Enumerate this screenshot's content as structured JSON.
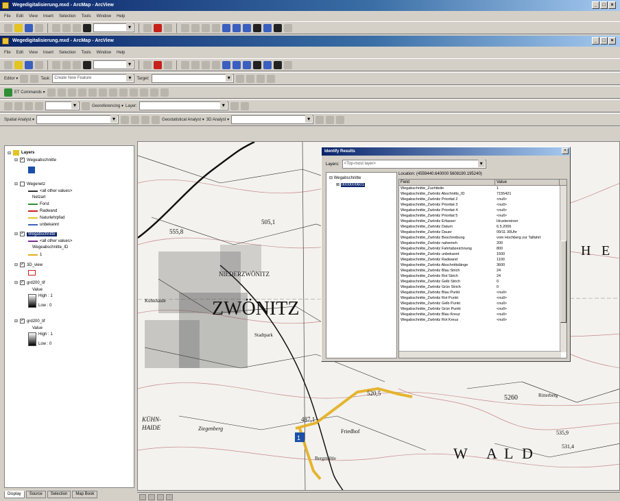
{
  "outer_window": {
    "title": "Wegedigitalisierung.mxd - ArcMap - ArcView"
  },
  "inner_window": {
    "title": "Wegedigitalisierung.mxd - ArcMap - ArcView"
  },
  "menus": [
    "File",
    "Edit",
    "View",
    "Insert",
    "Selection",
    "Tools",
    "Window",
    "Help"
  ],
  "editor_toolbar": {
    "editor_label": "Editor ▾",
    "task_label": "Task:",
    "task_value": "Create New Feature",
    "target_label": "Target:"
  },
  "toolbars": {
    "command_label": "ET Commands ▾",
    "spatial_analyst_label": "Spatial Analyst ▾",
    "georef_label": "Georeferencing ▾",
    "layer_label": "Layer:",
    "geostat_label": "Geostatistical Analyst ▾",
    "network_label": "3D Analyst ▾"
  },
  "toc": {
    "root": "Layers",
    "layers": [
      {
        "name": "Wegeabschnitte",
        "checked": true
      },
      {
        "name": "Wegenetz",
        "checked": false
      },
      {
        "name": "Wegabschnitte",
        "checked": true,
        "selected": true
      },
      {
        "name": "3D_view",
        "checked": true
      },
      {
        "name": "grd200_tif",
        "checked": true
      },
      {
        "name": "grd200_tif",
        "checked": true
      }
    ],
    "legend": {
      "all_other": "<all other values>",
      "netzart": "Netzart",
      "items": [
        "Forst",
        "Radwand",
        "Naturlehrpfad",
        "unbekannt"
      ],
      "field_label": "Wegeabschnitte_ID",
      "value_label": "Value",
      "high": "High : 1",
      "low": "Low : 0"
    },
    "tabs": [
      "Display",
      "Source",
      "Selection",
      "Map Book"
    ]
  },
  "map": {
    "labels": [
      "ZWÖNITZ",
      "H",
      "E",
      "W",
      "A",
      "L",
      "D",
      "NIEDERZWÖNITZ",
      "KÜHN-",
      "HAIDE",
      "Ziegenberg",
      "Kühnhaide",
      "Friedhof",
      "Bergmühle",
      "Ritterberg",
      "Stadtpark"
    ],
    "elevation_labels": [
      "555,8",
      "505,1",
      "487,1",
      "520,5",
      "5260",
      "535,9",
      "531,4"
    ],
    "colors": {
      "route": "#e3ad1c",
      "roads": "#222222",
      "contours": "#b45a5a"
    }
  },
  "identify": {
    "title": "Identify Results",
    "layers_label": "Layers:",
    "layers_value": "<Top-most layer>",
    "tree_root": "Wegabschnitte",
    "tree_child": "0000000601",
    "location": "Location: (4559440.640000 5608190.195240)",
    "columns": [
      "Field",
      "Value"
    ],
    "rows": [
      [
        "Wegabschnitte_Zuchtteile",
        "1"
      ],
      [
        "Wegabschnitte_Zwönitz Abschnitts_ID",
        "7155421"
      ],
      [
        "Wegabschnitte_Zwönitz Prioritat 2",
        "<null>"
      ],
      [
        "Wegabschnitte_Zwönitz Prioritat 3",
        "<null>"
      ],
      [
        "Wegabschnitte_Zwönitz Prioritat 4",
        "<null>"
      ],
      [
        "Wegabschnitte_Zwönitz Prioritat 5",
        "<null>"
      ],
      [
        "Wegabschnitte_Zwönitz Erfasser",
        "Hrustereinen"
      ],
      [
        "Wegabschnitte_Zwönitz Datum",
        "6.5.2006"
      ],
      [
        "Wegabschnitte_Zwönitz Dauer",
        "09/11 30Uhr"
      ],
      [
        "Wegabschnitte_Zwönitz Beschreibung",
        "vom Hochberg zur Talfahrt"
      ],
      [
        "Wegabschnitte_Zwönitz nahemeh",
        "200"
      ],
      [
        "Wegabschnitte_Zwönitz Fahrtabzeichnung",
        "800"
      ],
      [
        "Wegabschnitte_Zwönitz unbekannt",
        "1500"
      ],
      [
        "Wegabschnitte_Zwönitz Radwand",
        "1100"
      ],
      [
        "Wegabschnitte_Zwönitz Abschnittslänge",
        "3600"
      ],
      [
        "Wegabschnitte_Zwönitz Blau Strich",
        "24"
      ],
      [
        "Wegabschnitte_Zwönitz Rot Strich",
        "24"
      ],
      [
        "Wegabschnitte_Zwönitz Gelb Strich",
        "0"
      ],
      [
        "Wegabschnitte_Zwönitz Grün Strich",
        "0"
      ],
      [
        "Wegabschnitte_Zwönitz Blau Punkt",
        "<null>"
      ],
      [
        "Wegabschnitte_Zwönitz Rot Punkt",
        "<null>"
      ],
      [
        "Wegabschnitte_Zwönitz Gelb Punkt",
        "<null>"
      ],
      [
        "Wegabschnitte_Zwönitz Grün Punkt",
        "<null>"
      ],
      [
        "Wegabschnitte_Zwönitz Blau Kreuz",
        "<null>"
      ],
      [
        "Wegabschnitte_Zwönitz Rot Kreuz",
        "<null>"
      ]
    ]
  }
}
